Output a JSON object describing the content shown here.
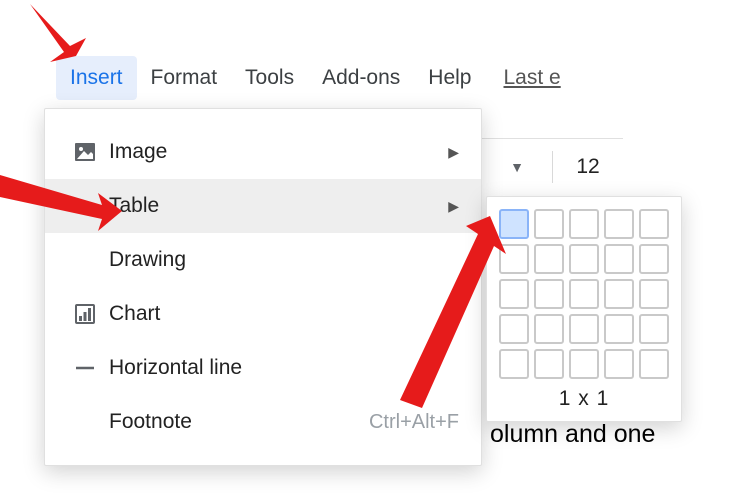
{
  "menubar": {
    "insert": "Insert",
    "format": "Format",
    "tools": "Tools",
    "addons": "Add-ons",
    "help": "Help",
    "last_edit": "Last e"
  },
  "toolbar": {
    "font_size": "12"
  },
  "dropdown": {
    "image": "Image",
    "table": "Table",
    "drawing": "Drawing",
    "chart": "Chart",
    "hline": "Horizontal line",
    "footnote": "Footnote",
    "footnote_shortcut": "Ctrl+Alt+F"
  },
  "table_picker": {
    "label": "1 x 1"
  },
  "doc": {
    "text_fragment": "olumn and one"
  }
}
